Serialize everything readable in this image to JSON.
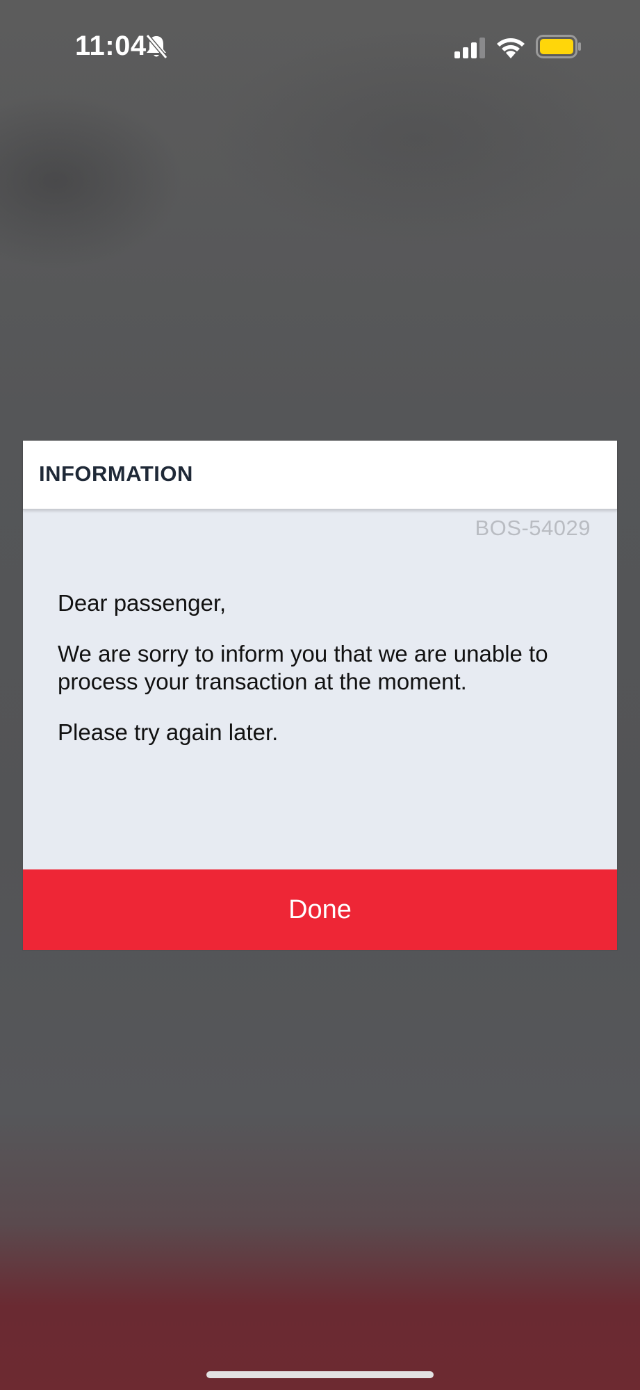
{
  "status_bar": {
    "time": "11:04",
    "icons": [
      "bell-slash-icon",
      "cellular-signal-icon",
      "wifi-icon",
      "battery-icon"
    ],
    "battery_color": "#ffd60a"
  },
  "dialog": {
    "title": "INFORMATION",
    "error_code": "BOS-54029",
    "greeting": "Dear passenger,",
    "body": "We are sorry to inform you that we are unable to process your transaction at the moment.",
    "footer_note": "Please try again later.",
    "done_label": "Done",
    "accent_color": "#ee2636"
  }
}
